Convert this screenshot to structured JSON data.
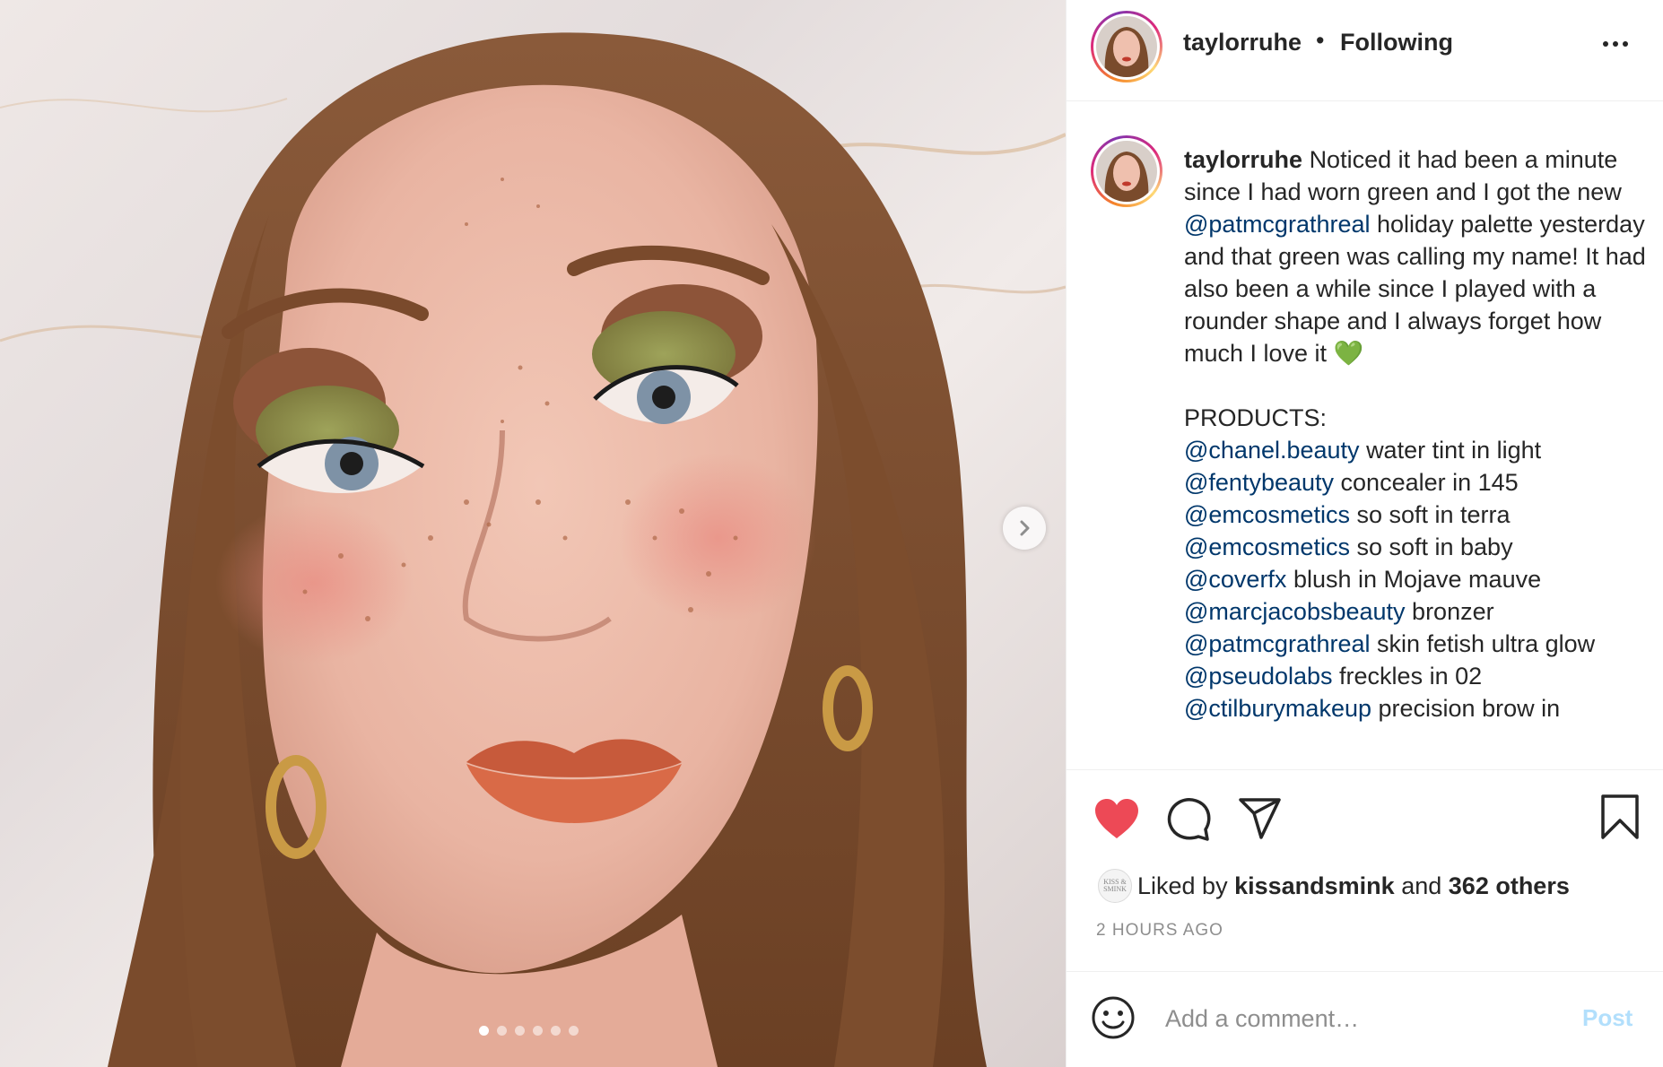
{
  "post": {
    "username": "taylorruhe",
    "separator": "•",
    "follow_status": "Following",
    "image_alt": "Close-up portrait with green eyeshadow, freckles and orange lips",
    "carousel": {
      "count": 6,
      "active_index": 0
    }
  },
  "caption": {
    "username": "taylorruhe",
    "intro_before": "Noticed it had been a minute since I had worn green and I got the new",
    "intro_mention": "@patmcgrathreal",
    "intro_after": "holiday palette yesterday and that green was calling my name! It had also been a while since I played with a rounder shape and I always forget how much I love it 💚",
    "products_heading": "PRODUCTS:",
    "products": [
      {
        "handle": "@chanel.beauty",
        "text": "water tint in light"
      },
      {
        "handle": "@fentybeauty",
        "text": "concealer in 145"
      },
      {
        "handle": "@emcosmetics",
        "text": "so soft in terra"
      },
      {
        "handle": "@emcosmetics",
        "text": "so soft in baby"
      },
      {
        "handle": "@coverfx",
        "text": "blush in Mojave mauve"
      },
      {
        "handle": "@marcjacobsbeauty",
        "text": "bronzer"
      },
      {
        "handle": "@patmcgrathreal",
        "text": "skin fetish ultra glow"
      },
      {
        "handle": "@pseudolabs",
        "text": "freckles in 02"
      },
      {
        "handle": "@ctilburymakeup",
        "text": "precision brow in"
      }
    ]
  },
  "actions": {
    "like_icon": "heart-filled-icon",
    "comment_icon": "comment-icon",
    "share_icon": "paper-plane-icon",
    "save_icon": "bookmark-icon",
    "like_color": "#ed4956"
  },
  "likes": {
    "avatar_text": "KISS & SMINK",
    "prefix": "Liked by",
    "user": "kissandsmink",
    "middle": "and",
    "others": "362 others"
  },
  "timestamp": "2 HOURS AGO",
  "comment": {
    "emoji_icon": "smiley-icon",
    "placeholder": "Add a comment…",
    "post_label": "Post"
  },
  "colors": {
    "mention": "#00376b",
    "muted": "#8e8e8e",
    "post_disabled": "#b2dffc"
  }
}
